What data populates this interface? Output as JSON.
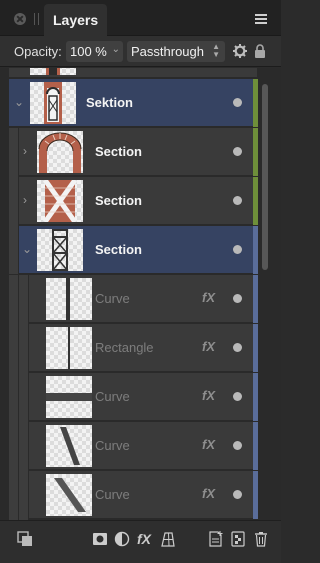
{
  "panel": {
    "tab_label": "Layers",
    "opacity_label": "Opacity:",
    "opacity_value": "100 %",
    "blend_mode": "Passthrough",
    "icons": [
      "close-icon",
      "grip-icon",
      "menu-icon",
      "gear-icon",
      "lock-icon"
    ]
  },
  "layers": [
    {
      "name": "Sektion",
      "type": "group",
      "expanded": true,
      "selected": true,
      "thumb": "arch-column",
      "tag_color": "#6e8f3a"
    },
    {
      "name": "Section",
      "type": "group",
      "expanded": false,
      "selected": false,
      "thumb": "brick-arch",
      "tag_color": "#6e8f3a"
    },
    {
      "name": "Section",
      "type": "group",
      "expanded": false,
      "selected": false,
      "thumb": "brick-cross",
      "tag_color": "#6e8f3a"
    },
    {
      "name": "Section",
      "type": "group",
      "expanded": true,
      "selected": true,
      "thumb": "lattice",
      "tag_color": "#5a6d9a"
    },
    {
      "name": "Curve",
      "type": "curve",
      "fx": "fX",
      "thumb": "vertical-bar",
      "tag_color": "#5a6d9a"
    },
    {
      "name": "Rectangle",
      "type": "rect",
      "fx": "fX",
      "thumb": "vertical-line",
      "tag_color": "#5a6d9a"
    },
    {
      "name": "Curve",
      "type": "curve",
      "fx": "fX",
      "thumb": "horizontal-bar",
      "tag_color": "#5a6d9a"
    },
    {
      "name": "Curve",
      "type": "curve",
      "fx": "fX",
      "thumb": "diagonal-bar",
      "tag_color": "#5a6d9a"
    },
    {
      "name": "Curve",
      "type": "curve",
      "fx": "fX",
      "thumb": "diagonal-bar-2",
      "tag_color": "#5a6d9a"
    }
  ],
  "footer": {
    "icons": [
      "layer-stack-icon",
      "mask-icon",
      "adjustment-icon",
      "fx-icon",
      "grid-icon",
      "add-page-icon",
      "group-icon",
      "trash-icon"
    ]
  }
}
